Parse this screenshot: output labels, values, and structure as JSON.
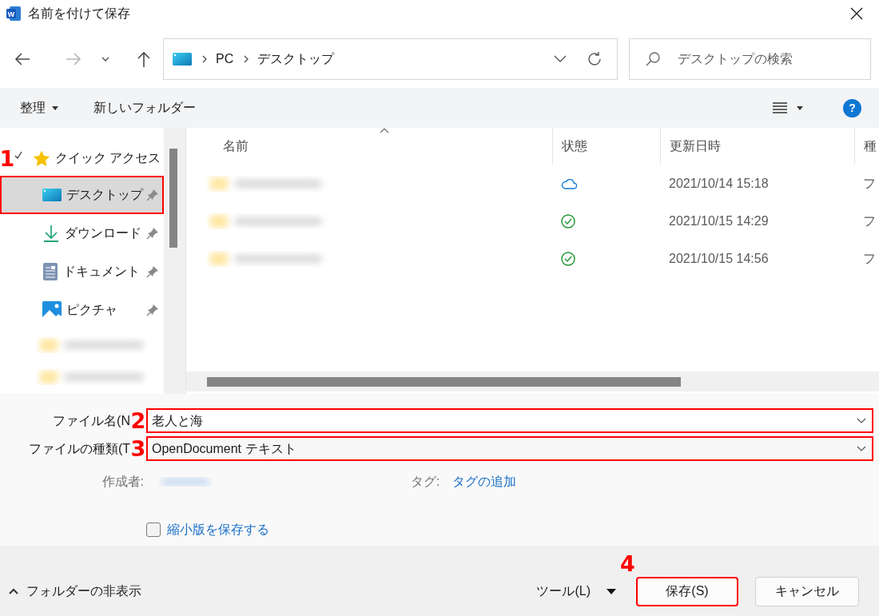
{
  "window": {
    "title": "名前を付けて保存",
    "icon_letter": "W"
  },
  "nav": {
    "back": {
      "disabled": false
    },
    "forward": {
      "disabled": true
    },
    "address": {
      "segments": [
        "PC",
        "デスクトップ"
      ]
    },
    "search": {
      "placeholder": "デスクトップの検索"
    }
  },
  "toolbar": {
    "organize": "整理",
    "new_folder": "新しいフォルダー",
    "help": "?"
  },
  "sidebar": {
    "items": [
      {
        "kind": "group",
        "label": "クイック アクセス",
        "expanded": true,
        "callout": "1",
        "children": [
          {
            "kind": "desktop",
            "label": "デスクトップ",
            "pinned": true,
            "selected": true,
            "highlighted": true
          },
          {
            "kind": "download",
            "label": "ダウンロード",
            "pinned": true,
            "selected": false,
            "highlighted": false
          },
          {
            "kind": "documents",
            "label": "ドキュメント",
            "pinned": true,
            "selected": false,
            "highlighted": false
          },
          {
            "kind": "pictures",
            "label": "ピクチャ",
            "pinned": true,
            "selected": false,
            "highlighted": false
          },
          {
            "kind": "picture"
          },
          {
            "kind": "picture"
          }
        ]
      }
    ]
  },
  "file_list": {
    "columns": [
      {
        "label": "名前",
        "sorted": true
      },
      {
        "label": "状態",
        "sorted": false
      },
      {
        "label": "更新日時",
        "sorted": false
      },
      {
        "label": "種",
        "sorted": false
      }
    ],
    "rows": [
      {
        "name": {
          "kind": "picture"
        },
        "status": {
          "kind": "cloud"
        },
        "modified": "2021/10/14 15:18",
        "column_4": "フ"
      },
      {
        "name": {
          "kind": "picture"
        },
        "status": {
          "kind": "synced"
        },
        "modified": "2021/10/15 14:29",
        "column_4": "フ"
      },
      {
        "name": {
          "kind": "picture"
        },
        "status": {
          "kind": "synced"
        },
        "modified": "2021/10/15 14:56",
        "column_4": "フ"
      }
    ]
  },
  "form": {
    "file_name": {
      "label": "ファイル名(N",
      "value": "老人と海",
      "highlighted": true,
      "callout": "2"
    },
    "file_type": {
      "label": "ファイルの種類(T",
      "value": "OpenDocument テキスト",
      "highlighted": true,
      "callout": "3"
    },
    "author": {
      "label": "作成者:",
      "value": {
        "kind": "picture"
      }
    },
    "tags": {
      "label": "タグ:",
      "link": "タグの追加"
    },
    "thumbnail": {
      "label": "縮小版を保存する",
      "checked": false
    }
  },
  "footer": {
    "hide_folders": "フォルダーの非表示",
    "tools": "ツール(L)",
    "save": {
      "label": "保存(S)",
      "highlighted": true,
      "callout": "4"
    },
    "cancel": "キャンセル"
  }
}
